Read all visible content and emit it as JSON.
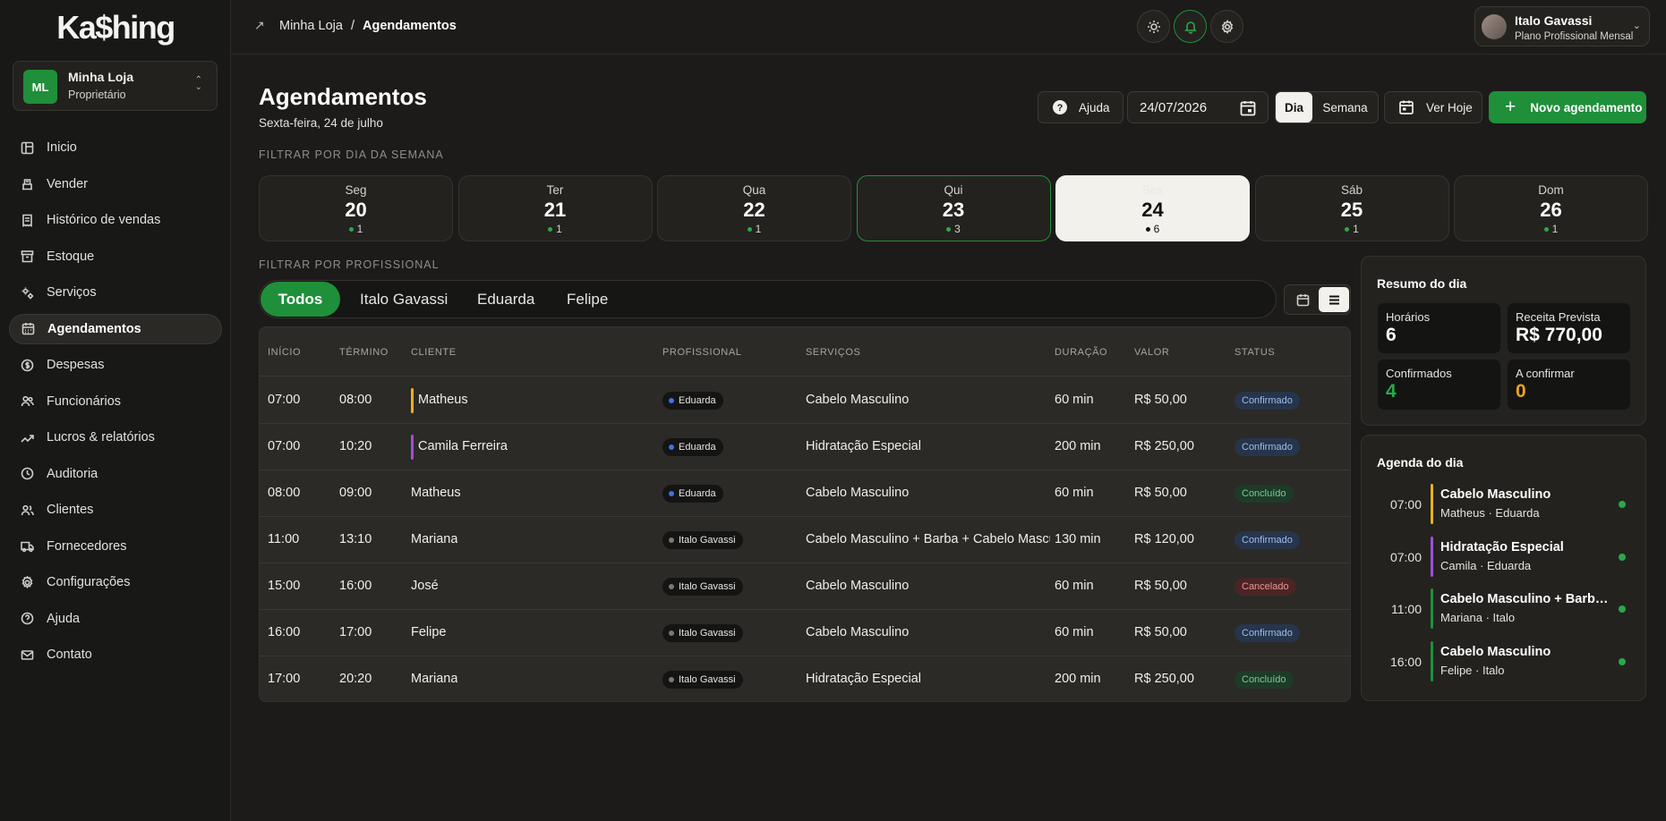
{
  "sidebar": {
    "logo": "Ka$hing",
    "store": {
      "initials": "ML",
      "name": "Minha Loja",
      "role": "Proprietário"
    },
    "items": [
      {
        "label": "Inicio",
        "icon": "dashboard-icon"
      },
      {
        "label": "Vender",
        "icon": "cash-register-icon"
      },
      {
        "label": "Histórico de vendas",
        "icon": "receipt-icon"
      },
      {
        "label": "Estoque",
        "icon": "archive-icon"
      },
      {
        "label": "Serviços",
        "icon": "gears-icon"
      },
      {
        "label": "Agendamentos",
        "icon": "calendar-icon",
        "active": true
      },
      {
        "label": "Despesas",
        "icon": "dollar-circle-icon"
      },
      {
        "label": "Funcionários",
        "icon": "users-icon"
      },
      {
        "label": "Lucros & relatórios",
        "icon": "trend-icon"
      },
      {
        "label": "Auditoria",
        "icon": "history-icon"
      },
      {
        "label": "Clientes",
        "icon": "clients-icon"
      },
      {
        "label": "Fornecedores",
        "icon": "truck-icon"
      },
      {
        "label": "Configurações",
        "icon": "gear-icon"
      },
      {
        "label": "Ajuda",
        "icon": "help-circle-icon"
      },
      {
        "label": "Contato",
        "icon": "mail-icon"
      }
    ]
  },
  "topbar": {
    "breadcrumb_parent": "Minha Loja",
    "breadcrumb_sep": "/",
    "breadcrumb_current": "Agendamentos",
    "user": {
      "name": "Italo Gavassi",
      "plan": "Plano Profissional Mensal"
    }
  },
  "header": {
    "title": "Agendamentos",
    "subtitle": "Sexta-feira, 24 de julho",
    "help_label": "Ajuda",
    "date_value": "24/07/2026",
    "view_day": "Dia",
    "view_week": "Semana",
    "today_label": "Ver Hoje",
    "new_label": "Novo agendamento"
  },
  "weekday_filter": {
    "label": "FILTRAR POR DIA DA SEMANA",
    "days": [
      {
        "name": "Seg",
        "num": "20",
        "count": "1"
      },
      {
        "name": "Ter",
        "num": "21",
        "count": "1"
      },
      {
        "name": "Qua",
        "num": "22",
        "count": "1"
      },
      {
        "name": "Qui",
        "num": "23",
        "count": "3",
        "today": true
      },
      {
        "name": "Sex",
        "num": "24",
        "count": "6",
        "selected": true
      },
      {
        "name": "Sáb",
        "num": "25",
        "count": "1"
      },
      {
        "name": "Dom",
        "num": "26",
        "count": "1"
      }
    ]
  },
  "professional_filter": {
    "label": "FILTRAR POR PROFISSIONAL",
    "tabs": [
      "Todos",
      "Italo Gavassi",
      "Eduarda",
      "Felipe"
    ]
  },
  "table": {
    "headers": [
      "INÍCIO",
      "TÉRMINO",
      "CLIENTE",
      "PROFISSIONAL",
      "SERVIÇOS",
      "DURAÇÃO",
      "VALOR",
      "STATUS"
    ],
    "rows": [
      {
        "start": "07:00",
        "end": "08:00",
        "client": "Matheus",
        "bar": "#e8b21f",
        "pro": "Eduarda",
        "pro_color": "#3f6fe8",
        "service": "Cabelo Masculino",
        "duration": "60 min",
        "value": "R$ 50,00",
        "status": "Confirmado",
        "status_type": "conf"
      },
      {
        "start": "07:00",
        "end": "10:20",
        "client": "Camila Ferreira",
        "bar": "#a04fd6",
        "pro": "Eduarda",
        "pro_color": "#3f6fe8",
        "service": "Hidratação Especial",
        "duration": "200 min",
        "value": "R$ 250,00",
        "status": "Confirmado",
        "status_type": "conf"
      },
      {
        "start": "08:00",
        "end": "09:00",
        "client": "Matheus",
        "bar": "",
        "pro": "Eduarda",
        "pro_color": "#3f6fe8",
        "service": "Cabelo Masculino",
        "duration": "60 min",
        "value": "R$ 50,00",
        "status": "Concluído",
        "status_type": "conc"
      },
      {
        "start": "11:00",
        "end": "13:10",
        "client": "Mariana",
        "bar": "",
        "pro": "Italo Gavassi",
        "pro_color": "#7a7873",
        "service": "Cabelo Masculino + Barba + Cabelo Masculino",
        "duration": "130 min",
        "value": "R$ 120,00",
        "status": "Confirmado",
        "status_type": "conf"
      },
      {
        "start": "15:00",
        "end": "16:00",
        "client": "José",
        "bar": "",
        "pro": "Italo Gavassi",
        "pro_color": "#7a7873",
        "service": "Cabelo Masculino",
        "duration": "60 min",
        "value": "R$ 50,00",
        "status": "Cancelado",
        "status_type": "canc"
      },
      {
        "start": "16:00",
        "end": "17:00",
        "client": "Felipe",
        "bar": "",
        "pro": "Italo Gavassi",
        "pro_color": "#7a7873",
        "service": "Cabelo Masculino",
        "duration": "60 min",
        "value": "R$ 50,00",
        "status": "Confirmado",
        "status_type": "conf"
      },
      {
        "start": "17:00",
        "end": "20:20",
        "client": "Mariana",
        "bar": "",
        "pro": "Italo Gavassi",
        "pro_color": "#7a7873",
        "service": "Hidratação Especial",
        "duration": "200 min",
        "value": "R$ 250,00",
        "status": "Concluído",
        "status_type": "conc"
      }
    ]
  },
  "summary": {
    "title": "Resumo do dia",
    "horarios_label": "Horários",
    "horarios_value": "6",
    "receita_label": "Receita Prevista",
    "receita_value": "R$ 770,00",
    "confirmados_label": "Confirmados",
    "confirmados_value": "4",
    "aconfirmar_label": "A confirmar",
    "aconfirmar_value": "0",
    "confirmados_color": "#29a84a",
    "aconfirmar_color": "#e8a41f"
  },
  "agenda": {
    "title": "Agenda do dia",
    "items": [
      {
        "time": "07:00",
        "title": "Cabelo Masculino",
        "sub": "Matheus · Eduarda",
        "bar": "#e8b21f"
      },
      {
        "time": "07:00",
        "title": "Hidratação Especial",
        "sub": "Camila · Eduarda",
        "bar": "#a04fd6"
      },
      {
        "time": "11:00",
        "title": "Cabelo Masculino + Barba + Cabelo Masculino",
        "sub": "Mariana · Italo",
        "bar": "#1f8f3a"
      },
      {
        "time": "16:00",
        "title": "Cabelo Masculino",
        "sub": "Felipe · Italo",
        "bar": "#1f8f3a"
      }
    ]
  }
}
